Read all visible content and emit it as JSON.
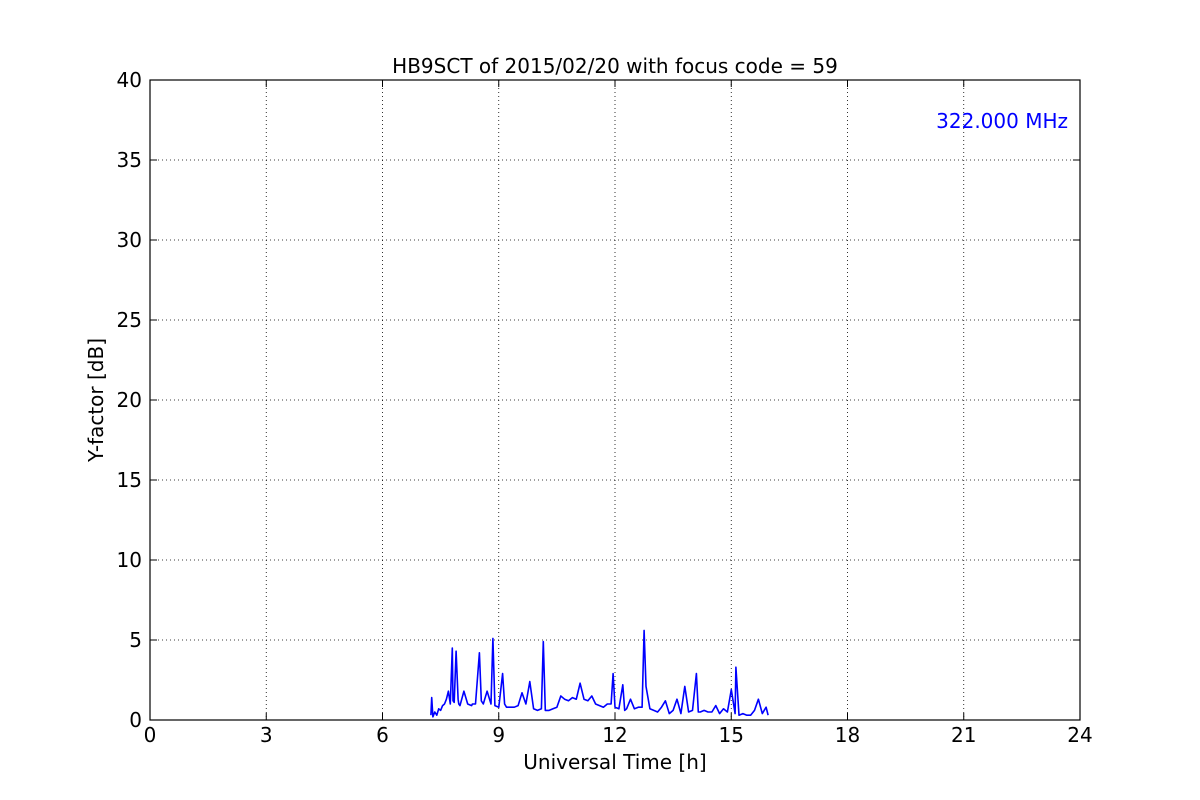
{
  "chart_data": {
    "type": "line",
    "title": "HB9SCT of 2015/02/20 with focus code = 59",
    "xlabel": "Universal Time [h]",
    "ylabel": "Y-factor [dB]",
    "xlim": [
      0,
      24
    ],
    "ylim": [
      0,
      40
    ],
    "xticks": [
      0,
      3,
      6,
      9,
      12,
      15,
      18,
      21,
      24
    ],
    "yticks": [
      0,
      5,
      10,
      15,
      20,
      25,
      30,
      35,
      40
    ],
    "grid": true,
    "annotation": {
      "text": "322.000 MHz",
      "color": "#0000ff",
      "placement": "top-right"
    },
    "series": [
      {
        "color": "#0000ff",
        "x": [
          7.25,
          7.27,
          7.3,
          7.35,
          7.4,
          7.45,
          7.5,
          7.55,
          7.6,
          7.65,
          7.7,
          7.75,
          7.8,
          7.82,
          7.85,
          7.9,
          7.95,
          7.97,
          8.0,
          8.1,
          8.2,
          8.3,
          8.32,
          8.4,
          8.5,
          8.55,
          8.6,
          8.7,
          8.8,
          8.85,
          8.9,
          9.0,
          9.1,
          9.15,
          9.2,
          9.3,
          9.4,
          9.5,
          9.6,
          9.7,
          9.8,
          9.9,
          10.0,
          10.1,
          10.15,
          10.2,
          10.3,
          10.4,
          10.5,
          10.6,
          10.7,
          10.8,
          10.9,
          11.0,
          11.1,
          11.2,
          11.3,
          11.4,
          11.5,
          11.6,
          11.7,
          11.8,
          11.9,
          11.95,
          12.0,
          12.1,
          12.2,
          12.25,
          12.3,
          12.4,
          12.5,
          12.6,
          12.7,
          12.75,
          12.8,
          12.9,
          13.0,
          13.1,
          13.2,
          13.3,
          13.4,
          13.5,
          13.6,
          13.7,
          13.8,
          13.9,
          14.0,
          14.1,
          14.15,
          14.2,
          14.3,
          14.4,
          14.5,
          14.6,
          14.7,
          14.8,
          14.9,
          15.0,
          15.1,
          15.12,
          15.2,
          15.3,
          15.4,
          15.5,
          15.6,
          15.7,
          15.8,
          15.9,
          15.95
        ],
        "y": [
          0.3,
          1.4,
          0.2,
          0.5,
          0.3,
          0.7,
          0.6,
          0.9,
          1.0,
          1.3,
          1.8,
          1.0,
          4.5,
          1.2,
          1.1,
          4.3,
          1.3,
          1.0,
          0.9,
          1.8,
          1.0,
          0.9,
          1.0,
          1.0,
          4.2,
          1.2,
          1.0,
          1.8,
          1.0,
          5.1,
          0.9,
          0.8,
          2.9,
          1.0,
          0.8,
          0.8,
          0.8,
          0.9,
          1.7,
          1.0,
          2.4,
          0.7,
          0.6,
          0.7,
          4.9,
          0.6,
          0.6,
          0.7,
          0.8,
          1.5,
          1.3,
          1.2,
          1.4,
          1.3,
          2.3,
          1.3,
          1.2,
          1.5,
          1.0,
          0.9,
          0.8,
          1.0,
          1.0,
          2.9,
          0.8,
          0.7,
          2.2,
          0.6,
          0.7,
          1.3,
          0.7,
          0.8,
          0.8,
          5.6,
          2.1,
          0.7,
          0.6,
          0.5,
          0.8,
          1.2,
          0.4,
          0.6,
          1.3,
          0.4,
          2.1,
          0.5,
          0.6,
          2.9,
          0.5,
          0.5,
          0.6,
          0.5,
          0.5,
          0.9,
          0.4,
          0.7,
          0.5,
          1.9,
          0.4,
          3.3,
          0.3,
          0.4,
          0.3,
          0.3,
          0.6,
          1.3,
          0.4,
          0.8,
          0.3
        ]
      }
    ]
  }
}
